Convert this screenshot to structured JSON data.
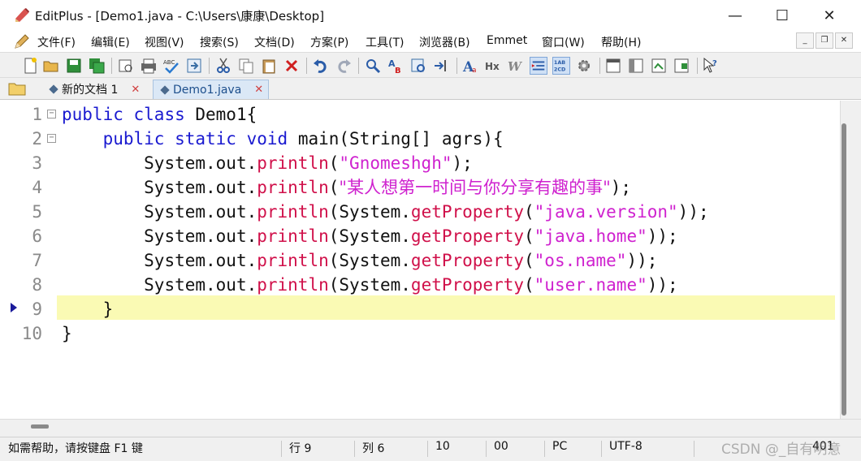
{
  "window": {
    "title": "EditPlus - [Demo1.java - C:\\Users\\康康\\Desktop]",
    "minimize_glyph": "—",
    "maximize_glyph": "☐",
    "close_glyph": "✕"
  },
  "menu": {
    "items": [
      "文件(F)",
      "编辑(E)",
      "视图(V)",
      "搜索(S)",
      "文档(D)",
      "方案(P)",
      "工具(T)",
      "浏览器(B)",
      "Emmet",
      "窗口(W)",
      "帮助(H)"
    ],
    "mdi_minimize": "_",
    "mdi_restore": "❐",
    "mdi_close": "✕"
  },
  "toolbar": {
    "icons": [
      "new-file-icon",
      "open-folder-icon",
      "save-icon",
      "save-all-icon",
      "print-preview-icon",
      "print-icon",
      "spellcheck-icon",
      "ftp-upload-icon",
      "cut-icon",
      "copy-icon",
      "paste-icon",
      "delete-icon",
      "undo-icon",
      "redo-icon",
      "find-icon",
      "replace-icon",
      "find-in-files-icon",
      "goto-icon",
      "font-icon",
      "hex-icon",
      "word-wrap-icon",
      "indent-icon",
      "line-number-icon",
      "settings-icon",
      "browser-icon",
      "cliptext-icon",
      "directory-icon",
      "user-tool-icon",
      "help-cursor-icon"
    ]
  },
  "tabs": [
    {
      "label": "新的文档 1",
      "close": "✕",
      "active": false
    },
    {
      "label": "Demo1.java",
      "close": "✕",
      "active": true
    }
  ],
  "editor": {
    "current_line": 9,
    "lines": [
      {
        "num": "1",
        "fold": "−"
      },
      {
        "num": "2",
        "fold": "−"
      },
      {
        "num": "3",
        "fold": ""
      },
      {
        "num": "4",
        "fold": ""
      },
      {
        "num": "5",
        "fold": ""
      },
      {
        "num": "6",
        "fold": ""
      },
      {
        "num": "7",
        "fold": ""
      },
      {
        "num": "8",
        "fold": ""
      },
      {
        "num": "9",
        "fold": ""
      },
      {
        "num": "10",
        "fold": ""
      }
    ],
    "code": {
      "l1_kw1": "public",
      "l1_kw2": "class",
      "l1_rest": " Demo1{",
      "l2_kw1": "public",
      "l2_kw2": "static",
      "l2_kw3": "void",
      "l2_rest": " main(String[] agrs){",
      "sysout": "System.out.",
      "println": "println",
      "getprop": "getProperty",
      "sys": "System.",
      "l3_str": "\"Gnomeshgh\"",
      "l4_str": "\"某人想第一时间与你分享有趣的事\"",
      "l5_str": "\"java.version\"",
      "l6_str": "\"java.home\"",
      "l7_str": "\"os.name\"",
      "l8_str": "\"user.name\"",
      "l9": "}",
      "l10": "}"
    }
  },
  "status": {
    "help": "如需帮助，请按键盘 F1 键",
    "row": "行 9",
    "col": "列 6",
    "total_lines": "10",
    "code": "00",
    "mode": "PC",
    "encoding": "UTF-8",
    "last": "401"
  },
  "watermark": "CSDN @_自有明意"
}
